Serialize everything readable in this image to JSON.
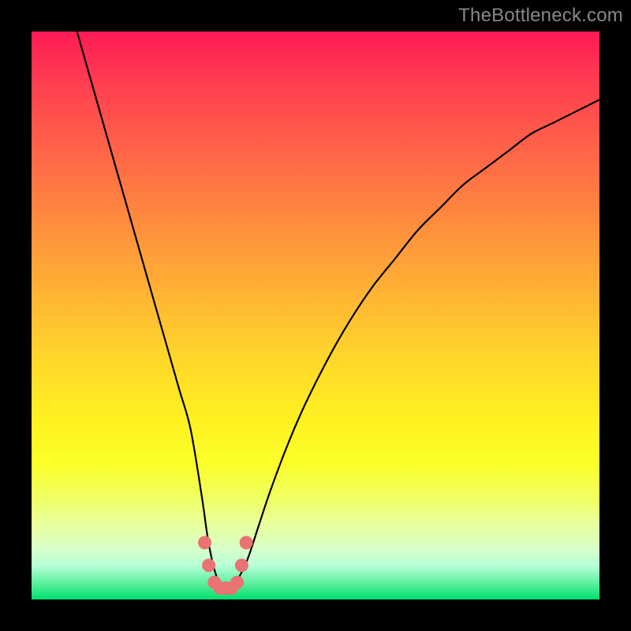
{
  "watermark": "TheBottleneck.com",
  "chart_data": {
    "type": "line",
    "title": "",
    "xlabel": "",
    "ylabel": "",
    "xlim": [
      0,
      100
    ],
    "ylim": [
      0,
      100
    ],
    "x": [
      8,
      10,
      12,
      14,
      16,
      18,
      20,
      22,
      24,
      26,
      28,
      30,
      31,
      32,
      33,
      34,
      35,
      36,
      38,
      40,
      42,
      45,
      48,
      52,
      56,
      60,
      64,
      68,
      72,
      76,
      80,
      84,
      88,
      92,
      96,
      100
    ],
    "y": [
      100,
      93,
      86,
      79,
      72,
      65,
      58,
      51,
      44,
      37,
      30,
      18,
      11,
      6,
      3,
      2,
      2,
      3,
      7,
      13,
      19,
      27,
      34,
      42,
      49,
      55,
      60,
      65,
      69,
      73,
      76,
      79,
      82,
      84,
      86,
      88
    ],
    "markers": {
      "x": [
        30.5,
        31.2,
        32.2,
        33.2,
        34.2,
        35.2,
        36.2,
        37.0,
        37.8
      ],
      "y": [
        10,
        6,
        3,
        2,
        2,
        2,
        3,
        6,
        10
      ]
    },
    "colors": {
      "line": "#000000",
      "marker": "#e97272"
    }
  }
}
